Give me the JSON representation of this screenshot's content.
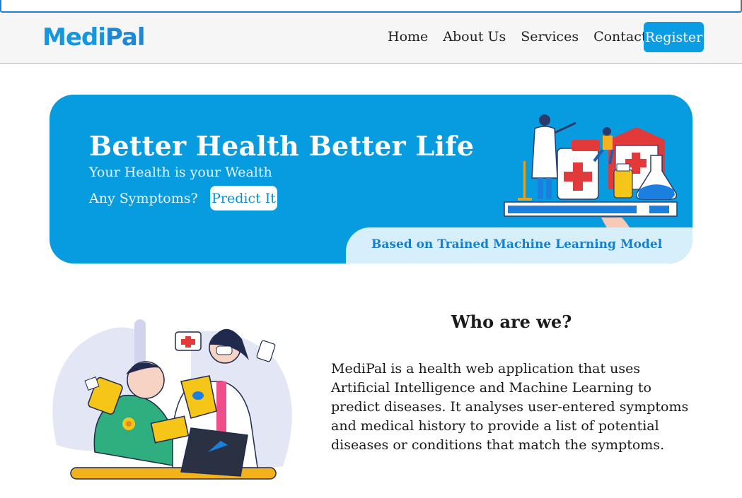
{
  "brand": {
    "logo_text_1": "Medi",
    "logo_text_2": "Pal"
  },
  "nav": {
    "links": [
      "Home",
      "About Us",
      "Services",
      "Contact"
    ],
    "register_label": "Register"
  },
  "hero": {
    "title": "Better Health Better Life",
    "subtitle": "Your Health is your Wealth",
    "cta_text": "Any Symptoms?",
    "predict_label": "Predict It",
    "strip_text": "Based on Trained Machine Learning Model"
  },
  "about": {
    "title": "Who are we?",
    "body": "MediPal is a health web application that uses Artificial Intelligence and Machine Learning to predict diseases. It analyses user-entered symptoms and medical history to provide a list of potential diseases or conditions that match the symptoms."
  },
  "colors": {
    "accent": "#0b9de3",
    "hero_bg": "#079be0",
    "strip_bg": "#d6effb"
  }
}
